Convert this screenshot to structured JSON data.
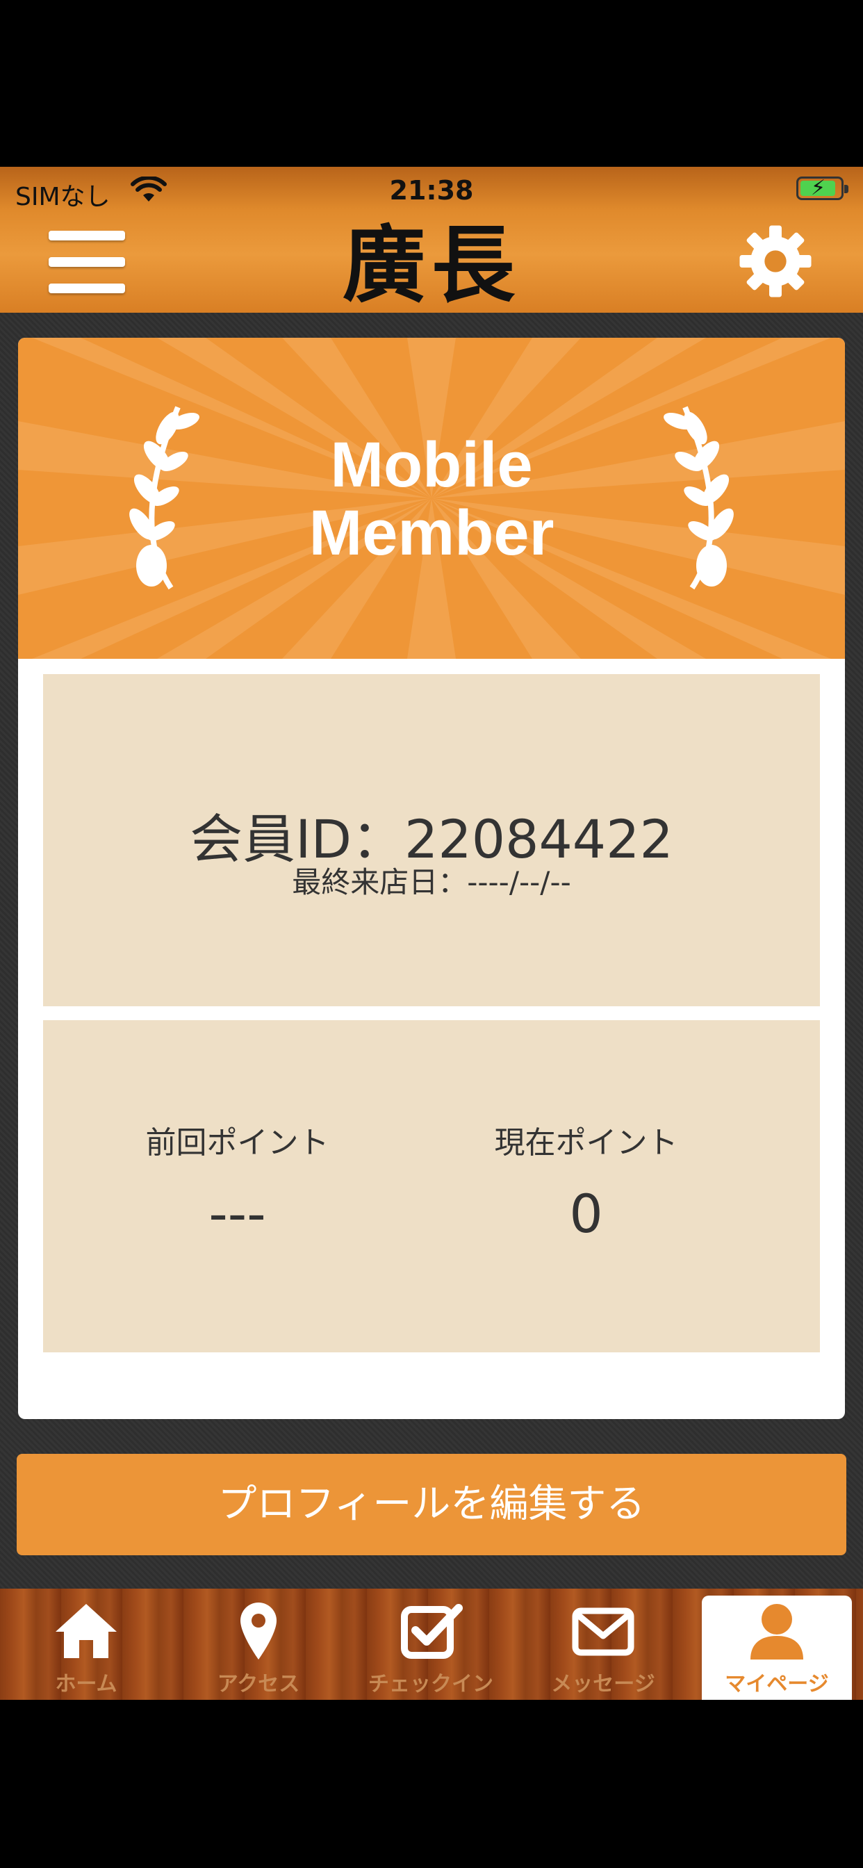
{
  "status_bar": {
    "carrier": "SIMなし",
    "time": "21:38"
  },
  "header": {
    "logo_text": "廣長",
    "menu_icon": "hamburger-menu-icon",
    "settings_icon": "gear-icon"
  },
  "banner": {
    "title_line1": "Mobile",
    "title_line2": "Member",
    "color": "#ef9637"
  },
  "member": {
    "id_label": "会員ID：22084422",
    "last_visit": "最終来店日：----/--/--"
  },
  "points": {
    "previous_label": "前回ポイント",
    "previous_value": "---",
    "current_label": "現在ポイント",
    "current_value": "0"
  },
  "edit_button": {
    "label": "プロフィールを編集する",
    "color": "#ec9538"
  },
  "tabs": [
    {
      "label": "ホーム",
      "icon": "home-icon"
    },
    {
      "label": "アクセス",
      "icon": "map-pin-icon"
    },
    {
      "label": "チェックイン",
      "icon": "checkbox-icon"
    },
    {
      "label": "メッセージ",
      "icon": "envelope-icon"
    },
    {
      "label": "マイページ",
      "icon": "user-icon",
      "active": true
    }
  ]
}
